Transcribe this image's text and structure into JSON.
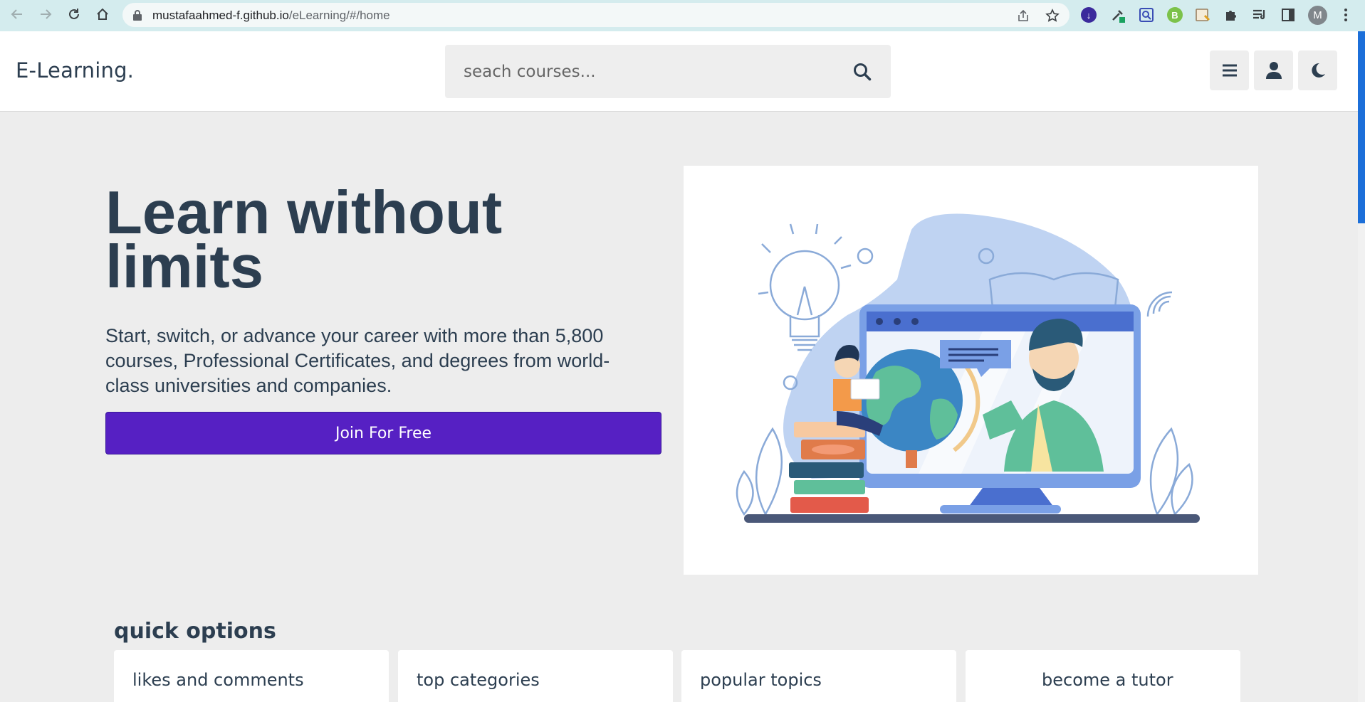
{
  "browser": {
    "url_domain": "mustafaahmed-f.github.io",
    "url_path": "/eLearning/#/home",
    "profile_initial": "M",
    "extensions": [
      "download-extension-icon",
      "eyedropper-extension-icon",
      "zoom-extension-icon",
      "b-extension-icon",
      "translate-extension-icon",
      "puzzle-extensions-icon",
      "reading-list-icon",
      "side-panel-icon"
    ]
  },
  "header": {
    "logo": "E-Learning.",
    "search_placeholder": "seach courses..."
  },
  "hero": {
    "title": "Learn without limits",
    "text": "Start, switch, or advance your career with more than 5,800 courses, Professional Certificates, and degrees from world-class universities and companies.",
    "cta": "Join For Free"
  },
  "quick_options": {
    "title": "quick options",
    "cards": [
      "likes and comments",
      "top categories",
      "popular topics",
      "become a tutor"
    ]
  },
  "colors": {
    "accent": "#5620c3",
    "text": "#2c3e50",
    "background": "#ededed",
    "browser_bar": "#d4ecee"
  }
}
